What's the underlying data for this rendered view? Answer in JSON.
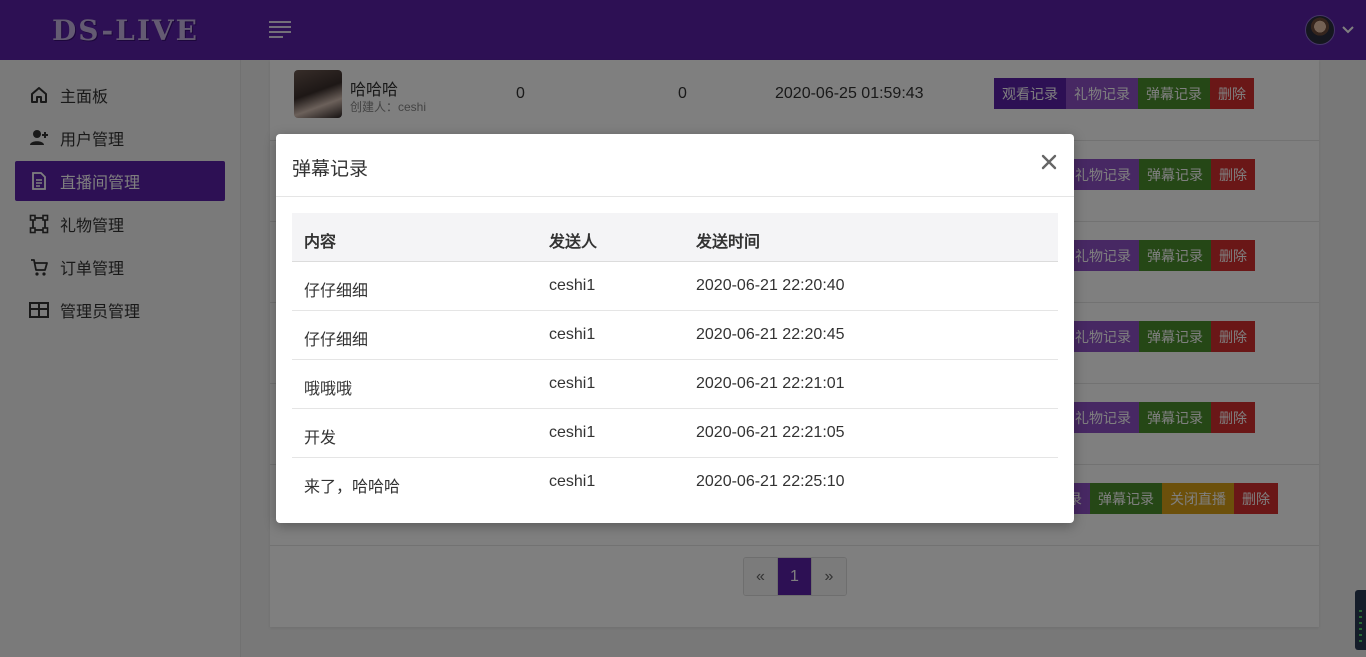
{
  "app": {
    "logo": "DS-LIVE"
  },
  "header": {
    "menu_icon": "hamburger-icon",
    "avatar_icon": "user-avatar",
    "caret_icon": "chevron-down-icon"
  },
  "sidebar": {
    "items": [
      {
        "label": "主面板",
        "icon": "home-icon",
        "active": false
      },
      {
        "label": "用户管理",
        "icon": "user-add-icon",
        "active": false
      },
      {
        "label": "直播间管理",
        "icon": "document-icon",
        "active": true
      },
      {
        "label": "礼物管理",
        "icon": "shape-icon",
        "active": false
      },
      {
        "label": "订单管理",
        "icon": "cart-icon",
        "active": false
      },
      {
        "label": "管理员管理",
        "icon": "table-icon",
        "active": false
      }
    ]
  },
  "rooms": {
    "first_row": {
      "name": "哈哈哈",
      "creator": "创建人：ceshi",
      "count_a": "0",
      "count_b": "0",
      "time": "2020-06-25 01:59:43"
    },
    "buttons": {
      "watch": "观看记录",
      "gift": "礼物记录",
      "danmu": "弹幕记录",
      "close_live": "关闭直播",
      "delete": "删除"
    },
    "last_row_partial_gift": "录"
  },
  "pagination": {
    "prev": "«",
    "current": "1",
    "next": "»"
  },
  "modal": {
    "title": "弹幕记录",
    "close": "×",
    "columns": [
      "内容",
      "发送人",
      "发送时间"
    ],
    "rows": [
      {
        "content": "仔仔细细",
        "sender": "ceshi1",
        "time": "2020-06-21 22:20:40"
      },
      {
        "content": "仔仔细细",
        "sender": "ceshi1",
        "time": "2020-06-21 22:20:45"
      },
      {
        "content": "哦哦哦",
        "sender": "ceshi1",
        "time": "2020-06-21 22:21:01"
      },
      {
        "content": "开发",
        "sender": "ceshi1",
        "time": "2020-06-21 22:21:05"
      },
      {
        "content": "来了，哈哈哈",
        "sender": "ceshi1",
        "time": "2020-06-21 22:25:10"
      }
    ]
  },
  "colors": {
    "primary": "#5b21a8",
    "gift": "#8e50c7",
    "danmu": "#4a8e2d",
    "warn": "#d9a016",
    "danger": "#d52e2e"
  }
}
